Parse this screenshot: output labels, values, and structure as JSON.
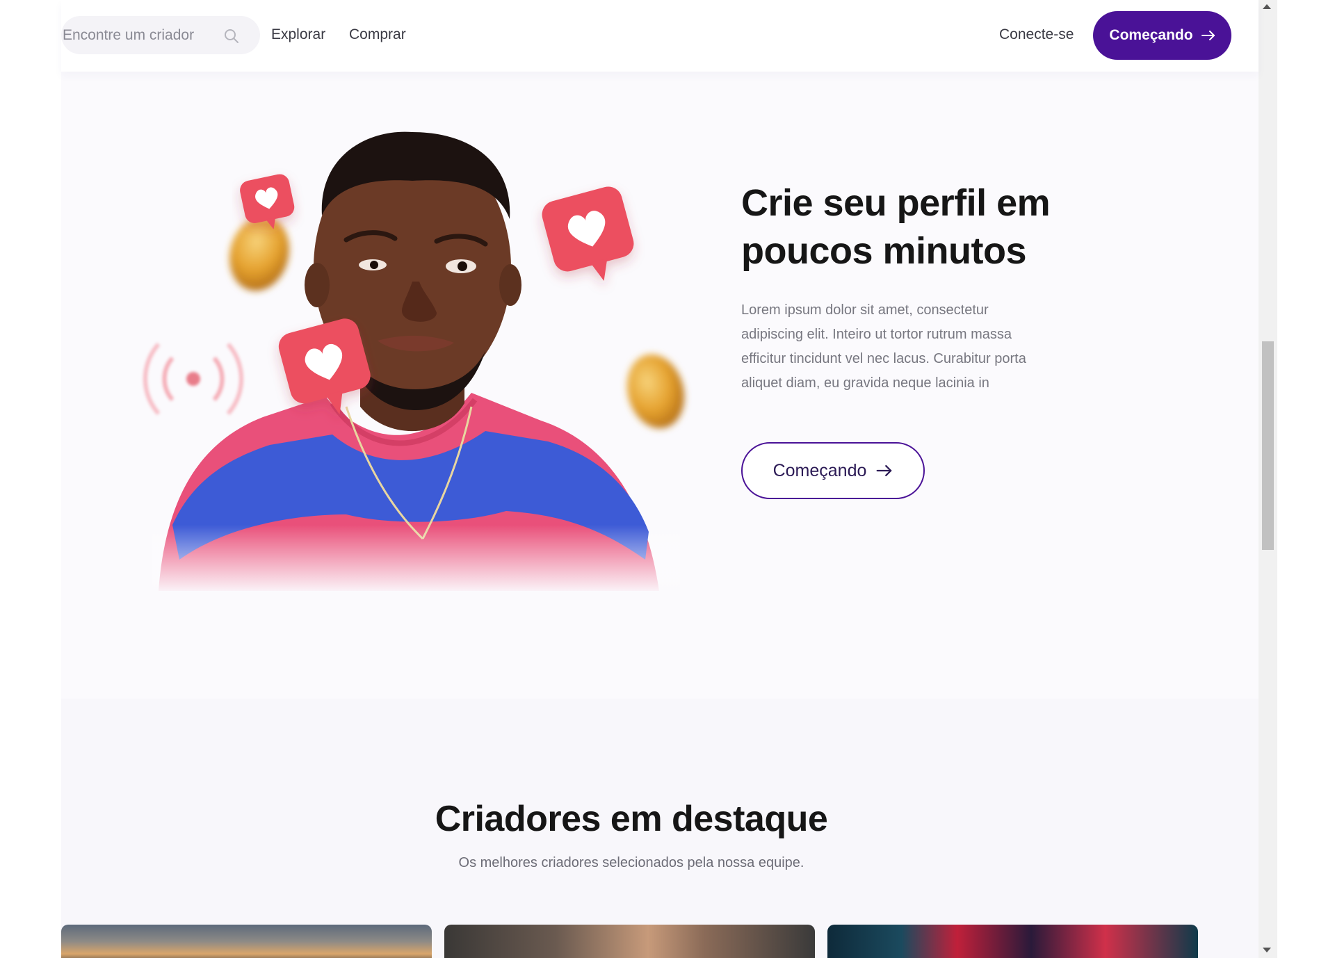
{
  "nav": {
    "search_placeholder": "Encontre um criador",
    "explore": "Explorar",
    "shop": "Comprar",
    "login": "Conecte-se",
    "cta": "Começando"
  },
  "hero": {
    "title": "Crie seu perfil em poucos minutos",
    "text": "Lorem ipsum dolor sit amet, consectetur adipiscing elit. Inteiro ut tortor rutrum massa efficitur tincidunt vel nec lacus. Curabitur porta aliquet diam, eu gravida neque lacinia in",
    "cta": "Começando"
  },
  "featured": {
    "title": "Criadores em destaque",
    "subtitle": "Os melhores criadores selecionados pela nossa equipe."
  },
  "colors": {
    "primary": "#4a1297",
    "heart": "#e8505b",
    "coin": "#e7a52f"
  },
  "icons": [
    "search-icon",
    "arrow-right-icon",
    "heart-icon",
    "coin-icon",
    "signal-icon"
  ]
}
